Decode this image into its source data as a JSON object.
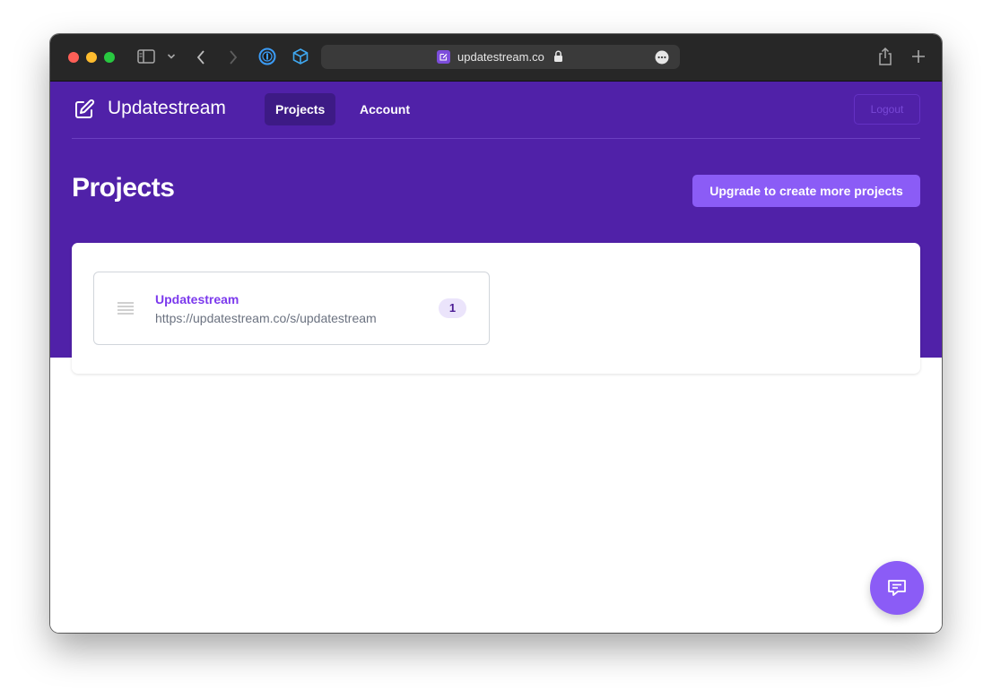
{
  "browser": {
    "url": "updatestream.co",
    "icons": [
      "sidebar-icon",
      "chevron-down-icon",
      "back-icon",
      "forward-icon",
      "password-manager-icon",
      "cube-extension-icon",
      "lock-icon",
      "more-icon",
      "share-icon",
      "new-tab-icon"
    ]
  },
  "app": {
    "brand": "Updatestream",
    "brand_icon": "edit-icon",
    "nav": [
      {
        "label": "Projects",
        "active": true
      },
      {
        "label": "Account",
        "active": false
      }
    ],
    "logout_label": "Logout"
  },
  "main": {
    "title": "Projects",
    "upgrade_label": "Upgrade to create more projects",
    "projects": [
      {
        "name": "Updatestream",
        "url": "https://updatestream.co/s/updatestream",
        "count": "1"
      }
    ]
  },
  "colors": {
    "header_bg": "#5021a8",
    "accent": "#8b5cf6",
    "link": "#7c3aed",
    "active_nav": "#3d1a85"
  },
  "chat_button_icon": "chat-icon"
}
